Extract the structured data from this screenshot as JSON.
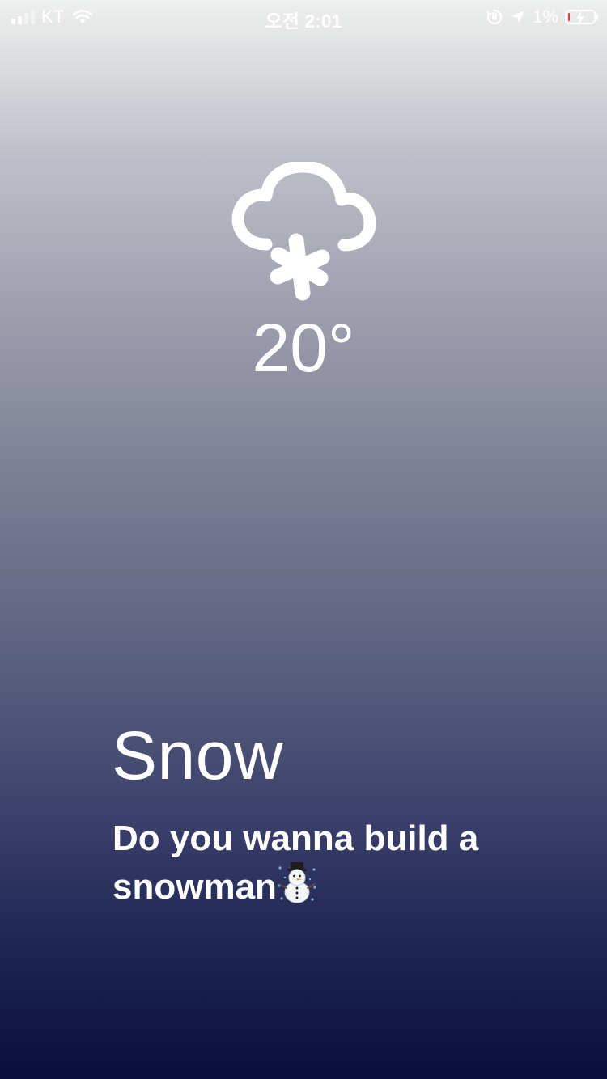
{
  "status_bar": {
    "carrier": "KT",
    "time": "오전 2:01",
    "battery_percent": "1%",
    "battery_level": 0.01,
    "icons": [
      "signal-icon",
      "wifi-icon",
      "orientation-lock-icon",
      "location-arrow-icon",
      "battery-charging-icon"
    ]
  },
  "weather": {
    "icon": "cloud-snow-icon",
    "temperature": "20°",
    "condition": "Snow",
    "message": "Do you wanna build a snowman",
    "message_emoji": "snowman-icon"
  },
  "colors": {
    "background_top": "#eef0ef",
    "background_bottom": "#080d3e",
    "text": "#ffffff",
    "battery_low": "#e53935"
  }
}
